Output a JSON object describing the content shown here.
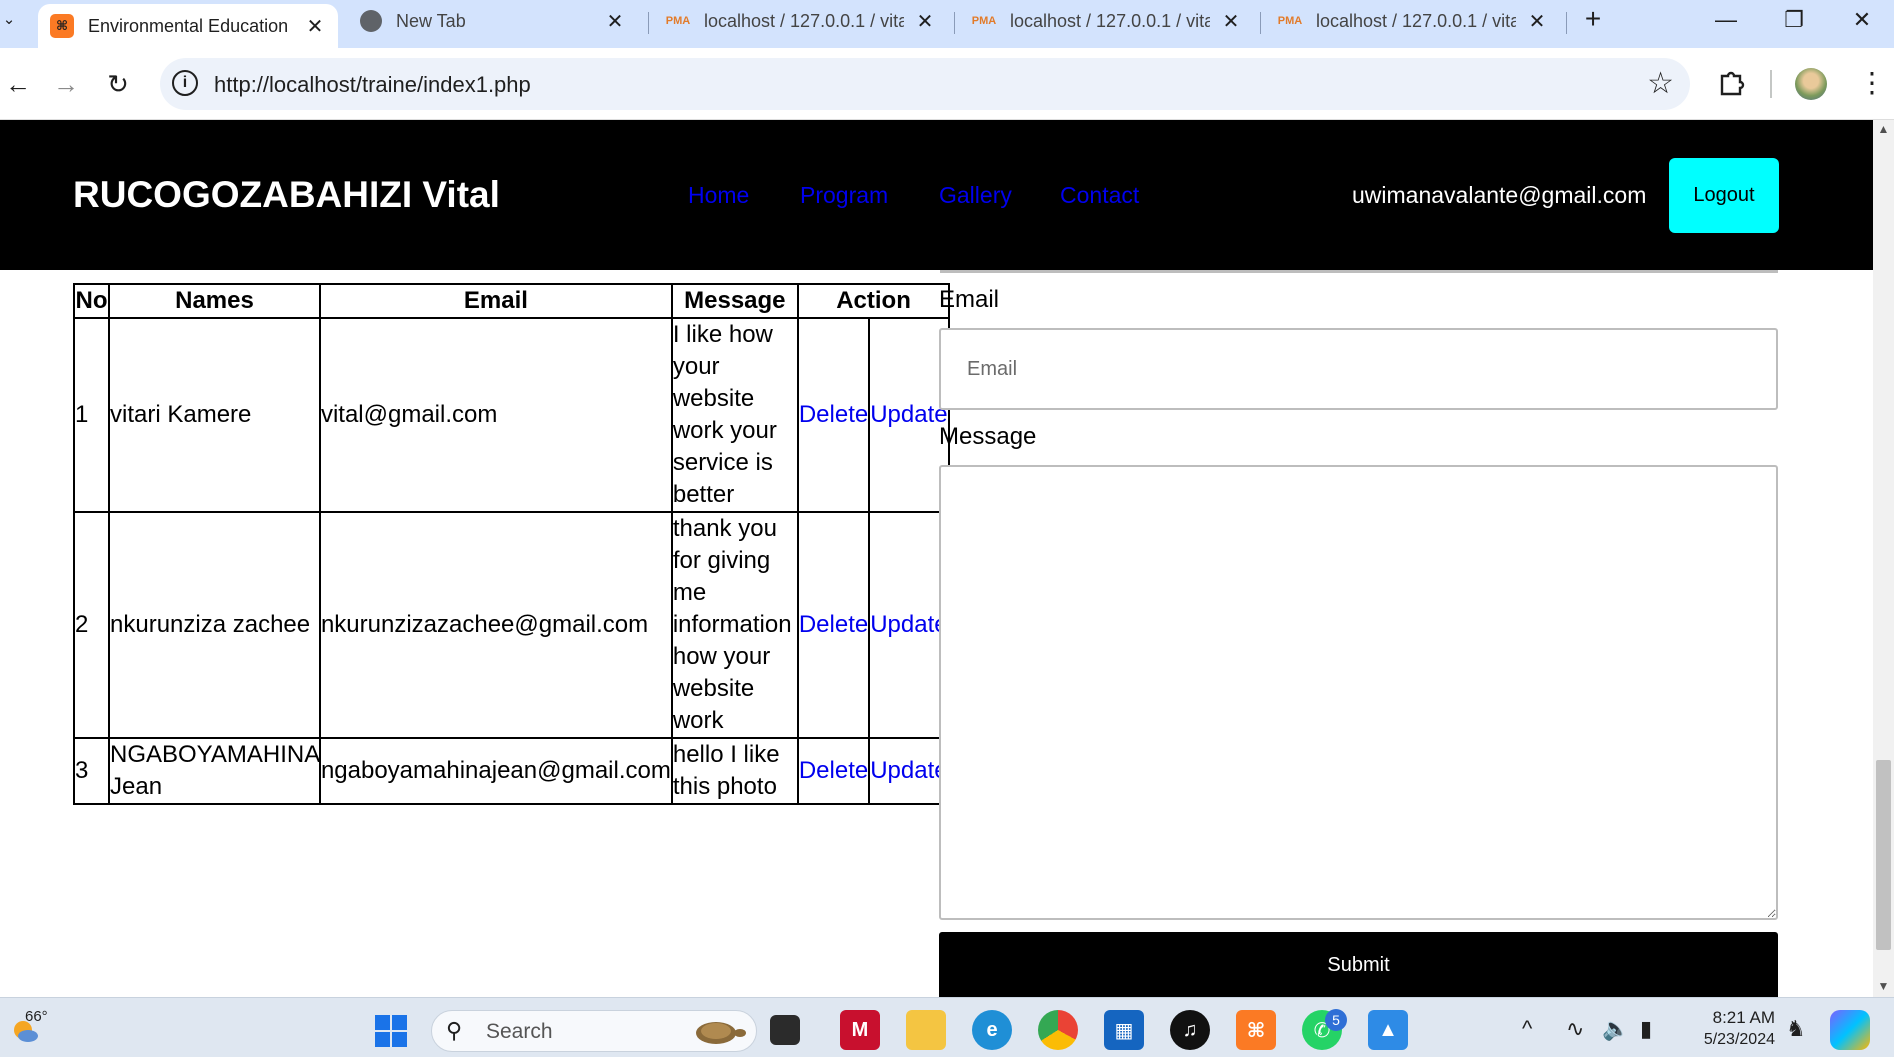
{
  "browser": {
    "tabs": [
      {
        "label": "Environmental Education",
        "icon": "xampp-icon",
        "active": true
      },
      {
        "label": "New Tab",
        "icon": "globe-icon",
        "active": false
      },
      {
        "label": "localhost / 127.0.0.1 / vita",
        "icon": "phpmyadmin-icon",
        "active": false
      },
      {
        "label": "localhost / 127.0.0.1 / vita",
        "icon": "phpmyadmin-icon",
        "active": false
      },
      {
        "label": "localhost / 127.0.0.1 / vita",
        "icon": "phpmyadmin-icon",
        "active": false
      }
    ],
    "url": "http://localhost/traine/index1.php"
  },
  "site": {
    "brand": "RUCOGOZABAHIZI Vital",
    "nav": [
      {
        "label": "Home"
      },
      {
        "label": "Program"
      },
      {
        "label": "Gallery"
      },
      {
        "label": "Contact"
      }
    ],
    "user_email": "uwimanavalante@gmail.com",
    "logout_label": "Logout"
  },
  "table": {
    "headers": [
      "No",
      "Names",
      "Email",
      "Message",
      "Action"
    ],
    "rows": [
      {
        "no": "1",
        "name": "vitari Kamere",
        "email": "vital@gmail.com",
        "message": "I like how your website work your service is better",
        "delete": "Delete",
        "update": "Update"
      },
      {
        "no": "2",
        "name": "nkurunziza zachee",
        "email": "nkurunzizazachee@gmail.com",
        "message": "thank you for giving me information how your website work",
        "delete": "Delete",
        "update": "Update"
      },
      {
        "no": "3",
        "name": "NGABOYAMAHINA Jean",
        "email": "ngaboyamahinajean@gmail.com",
        "message": "hello I like this photo",
        "delete": "Delete",
        "update": "Update"
      }
    ]
  },
  "form": {
    "email_label": "Email",
    "email_placeholder": "Email",
    "message_label": "Message",
    "submit_label": "Submit"
  },
  "taskbar": {
    "weather_temp": "66°",
    "search_placeholder": "Search",
    "whatsapp_badge": "5",
    "time": "8:21 AM",
    "date": "5/23/2024"
  },
  "colors": {
    "header_bg": "#000000",
    "logout_bg": "#00ffff",
    "link": "#0000ee",
    "tabstrip_bg": "#d3e3fd"
  }
}
